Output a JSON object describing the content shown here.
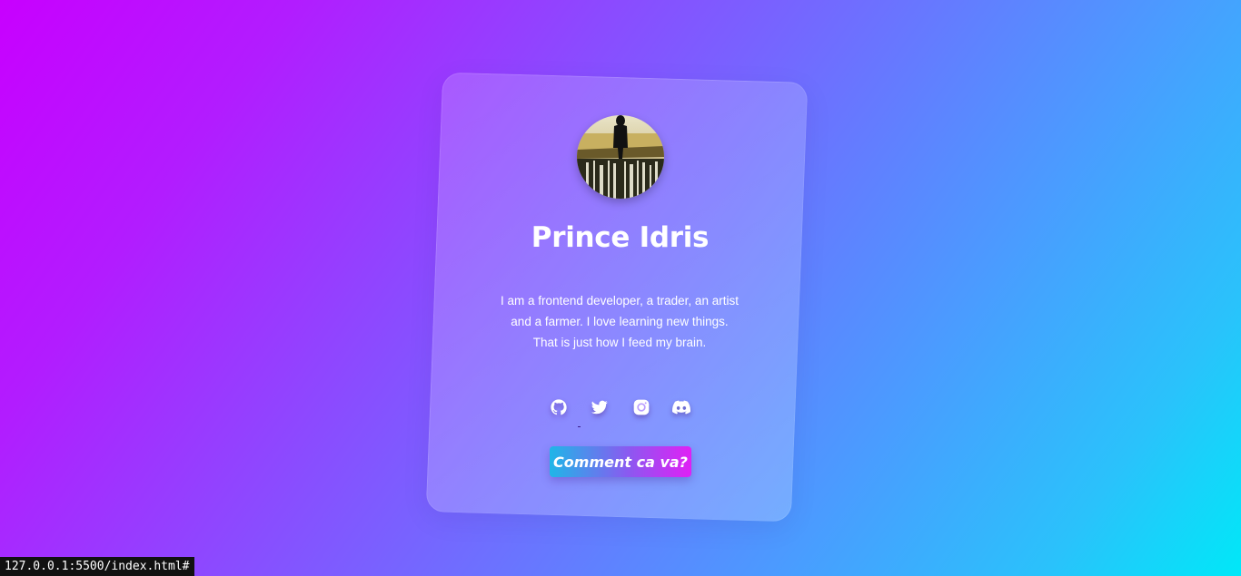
{
  "profile": {
    "name": "Prince Idris",
    "bio_lines": [
      "I am a frontend developer, a trader, an artist",
      "and a farmer. I love learning new things.",
      "That is just how I feed my brain."
    ],
    "avatar_icon": "person-on-bridge-photo"
  },
  "socials": [
    {
      "name": "github",
      "icon": "github-icon"
    },
    {
      "name": "twitter",
      "icon": "twitter-icon"
    },
    {
      "name": "instagram",
      "icon": "instagram-icon"
    },
    {
      "name": "discord",
      "icon": "discord-icon"
    }
  ],
  "cta": {
    "label": "Comment ca va?"
  },
  "statusbar": {
    "url": "127.0.0.1:5500/index.html#"
  },
  "colors": {
    "bg_start": "#c800ff",
    "bg_end": "#00e8f8",
    "cta_start": "#1fb6e8",
    "cta_end": "#e020f5"
  }
}
